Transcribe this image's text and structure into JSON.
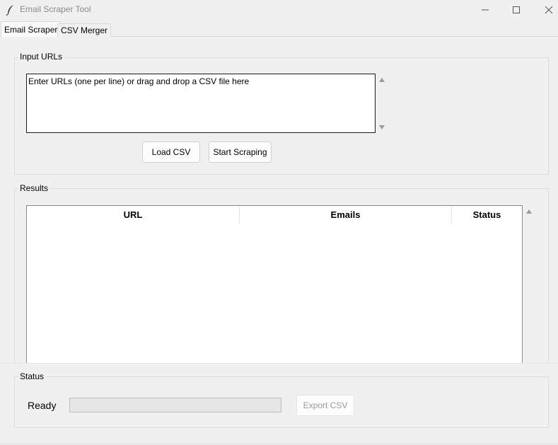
{
  "window": {
    "title": "Email Scraper Tool",
    "icon": "feather-icon",
    "controls": [
      "minimize-icon",
      "maximize-icon",
      "close-icon"
    ]
  },
  "tabs": [
    {
      "label": "Email Scraper",
      "selected": true
    },
    {
      "label": "CSV Merger",
      "selected": false
    }
  ],
  "input_section": {
    "label": "Input URLs",
    "placeholder": "Enter URLs (one per line) or drag and drop a CSV file here",
    "load_csv_label": "Load CSV",
    "start_label": "Start Scraping"
  },
  "results_section": {
    "label": "Results",
    "columns": [
      "URL",
      "Emails",
      "Status"
    ],
    "rows": []
  },
  "status_section": {
    "label": "Status",
    "status_text": "Ready",
    "progress": 0,
    "export_label": "Export CSV",
    "export_enabled": false
  }
}
